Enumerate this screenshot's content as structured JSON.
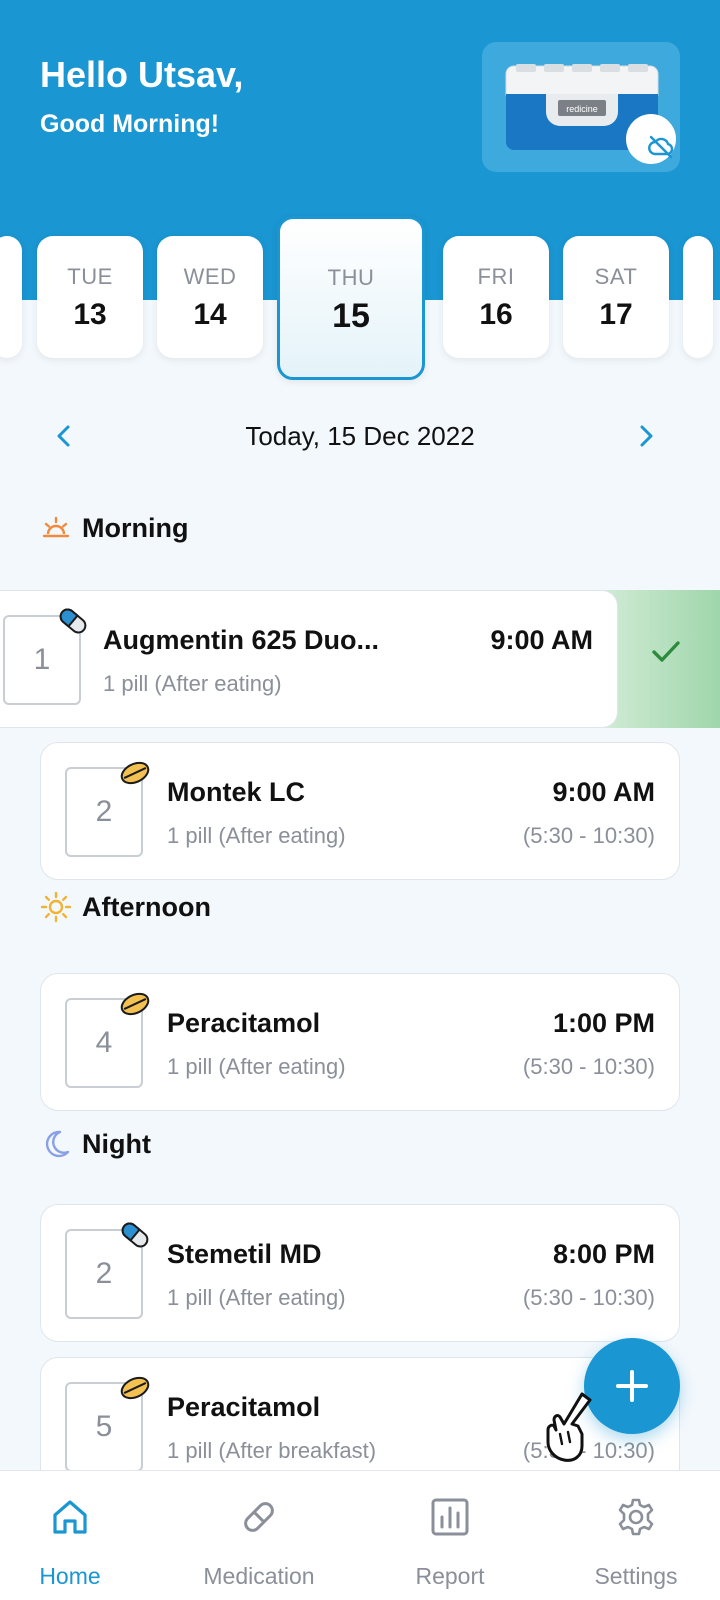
{
  "header": {
    "greeting": "Hello Utsav,",
    "subgreeting": "Good Morning!",
    "device_label": "redicine",
    "device_status_icon": "cloud-off-icon"
  },
  "colors": {
    "primary": "#1a96d2",
    "background": "#f3f8fc",
    "done_green": "#2e8b3e",
    "muted_text": "#8a8f99"
  },
  "dates": [
    {
      "dow": "TUE",
      "num": "13"
    },
    {
      "dow": "WED",
      "num": "14"
    },
    {
      "dow": "THU",
      "num": "15",
      "selected": true
    },
    {
      "dow": "FRI",
      "num": "16"
    },
    {
      "dow": "SAT",
      "num": "17"
    }
  ],
  "date_nav": {
    "today_label": "Today,  15 Dec 2022",
    "prev_icon": "chevron-left-icon",
    "next_icon": "chevron-right-icon"
  },
  "sections": {
    "morning": {
      "title": "Morning",
      "icon": "sunrise-icon",
      "meds": [
        {
          "slot": "1",
          "pill": "capsule",
          "name": "Augmentin 625 Duo...",
          "dose": "1 pill (After eating)",
          "time": "9:00 AM",
          "window": "",
          "taken": true
        },
        {
          "slot": "2",
          "pill": "tablet",
          "name": "Montek LC",
          "dose": "1 pill (After eating)",
          "time": "9:00 AM",
          "window": "(5:30 - 10:30)"
        }
      ]
    },
    "afternoon": {
      "title": "Afternoon",
      "icon": "sun-icon",
      "meds": [
        {
          "slot": "4",
          "pill": "tablet",
          "name": "Peracitamol",
          "dose": "1 pill (After eating)",
          "time": "1:00 PM",
          "window": "(5:30 - 10:30)"
        }
      ]
    },
    "night": {
      "title": "Night",
      "icon": "moon-icon",
      "meds": [
        {
          "slot": "2",
          "pill": "capsule",
          "name": "Stemetil MD",
          "dose": "1 pill (After eating)",
          "time": "8:00 PM",
          "window": "(5:30 - 10:30)"
        },
        {
          "slot": "5",
          "pill": "tablet",
          "name": "Peracitamol",
          "dose": "1 pill (After breakfast)",
          "time": "",
          "window": "(5:30 - 10:30)"
        }
      ]
    }
  },
  "fab": {
    "icon": "plus-icon"
  },
  "bottom_nav": [
    {
      "label": "Home",
      "icon": "home-icon",
      "active": true
    },
    {
      "label": "Medication",
      "icon": "pill-icon"
    },
    {
      "label": "Report",
      "icon": "bar-chart-icon"
    },
    {
      "label": "Settings",
      "icon": "gear-icon"
    }
  ]
}
